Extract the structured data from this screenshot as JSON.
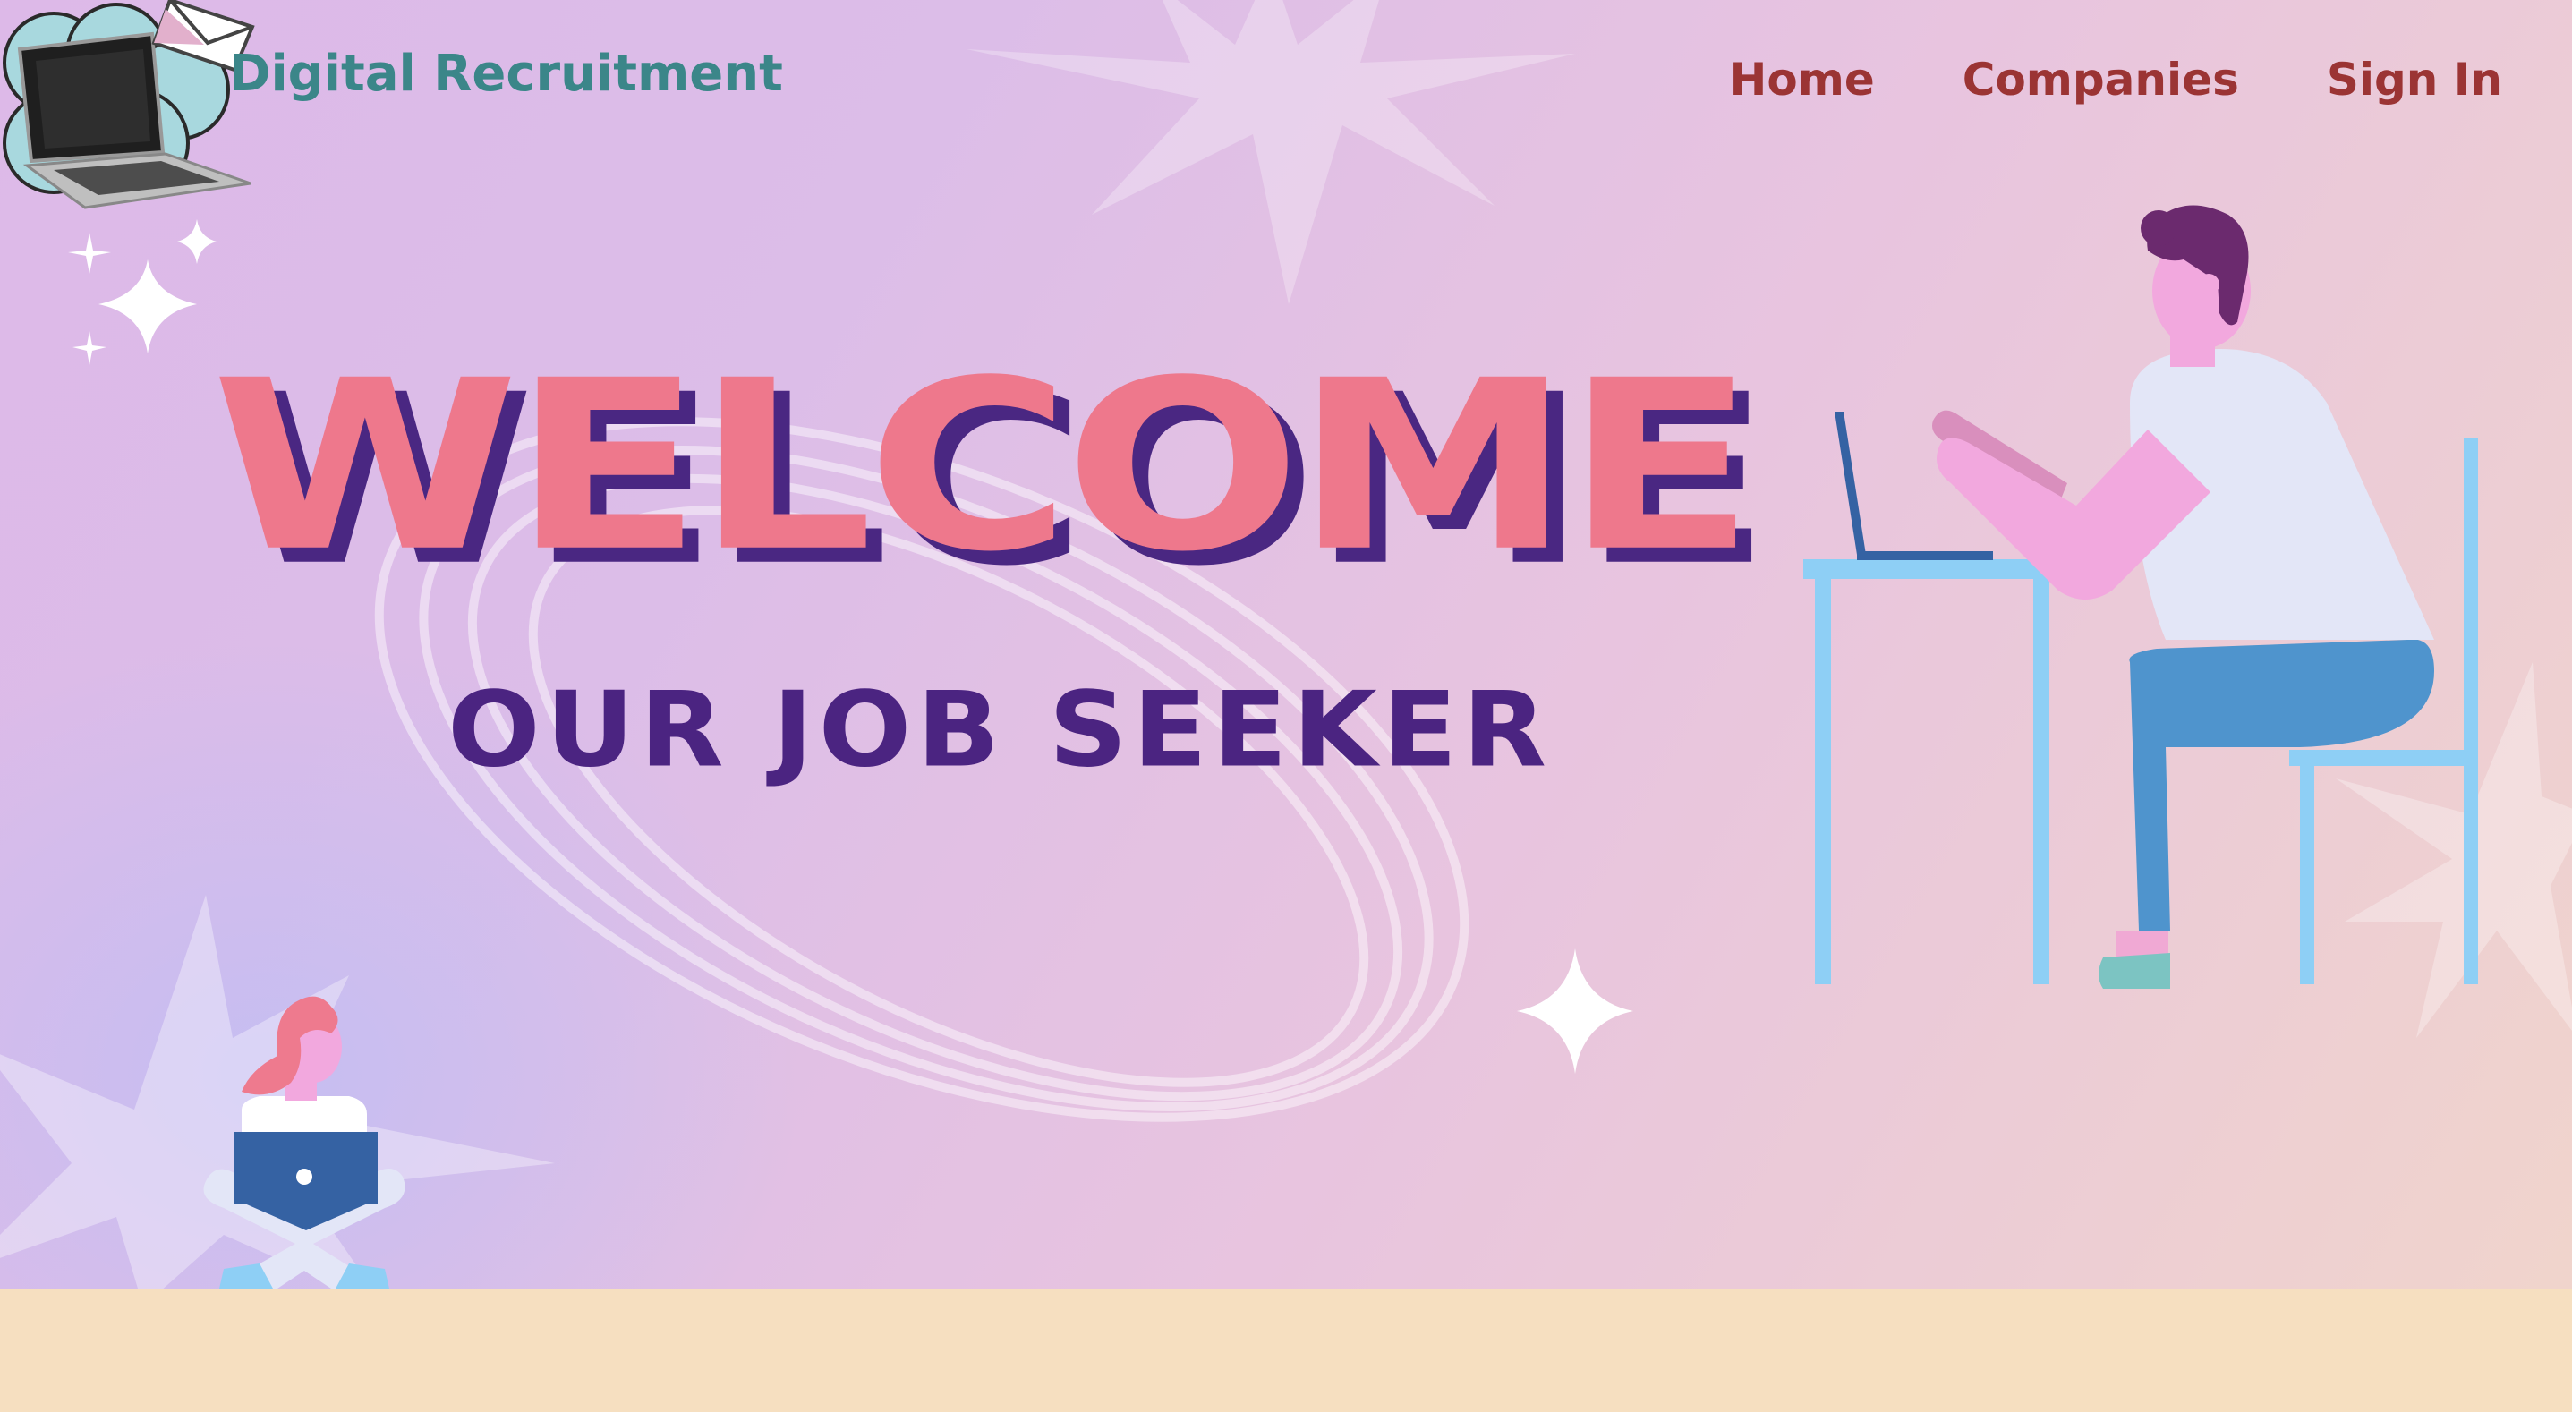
{
  "header": {
    "brand": "Digital Recruitment",
    "nav": [
      {
        "label": "Home"
      },
      {
        "label": "Companies"
      },
      {
        "label": "Sign In"
      }
    ]
  },
  "hero": {
    "headline": "WELCOME",
    "subheadline": "OUR JOB SEEKER"
  },
  "colors": {
    "brand": "#3b8689",
    "nav": "#9b3434",
    "headline": "#ee788c",
    "headline_shadow": "#4a2782",
    "subheadline": "#4b2481",
    "footer_band": "#f6dfc0"
  },
  "icons": [
    "laptop-mail-logo-icon",
    "sparkle-icon",
    "starburst-icon"
  ]
}
